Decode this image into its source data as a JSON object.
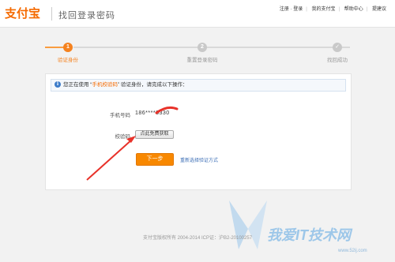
{
  "header": {
    "logo": "支付宝",
    "title": "找回登录密码",
    "links": [
      "注册 · 登录",
      "我的支付宝",
      "帮助中心",
      "提建议"
    ]
  },
  "steps": [
    {
      "num": "1",
      "label": "验证身份",
      "state": "active"
    },
    {
      "num": "2",
      "label": "重置登录密码",
      "state": "pending"
    },
    {
      "num": "✓",
      "label": "找回成功",
      "state": "pending"
    }
  ],
  "notice": {
    "prefix": "您正在使用 “",
    "method": "手机校验码",
    "suffix": "” 验证身份，请完成以下操作："
  },
  "form": {
    "phone_label": "手机号码",
    "phone_value": "186****3330",
    "code_label": "校验码",
    "code_button": "点此免费获取",
    "next_button": "下一步",
    "alt_link": "重新选择验证方式"
  },
  "footer": {
    "copyright": "支付宝版权所有 2004-2014 ICP证：沪B2-20100257"
  },
  "watermark": {
    "main": "我爱IT技术网",
    "sub": "www.52ij.com"
  },
  "colors": {
    "accent": "#f5821f",
    "link": "#3d6fb6",
    "annotation": "#e8322a"
  }
}
